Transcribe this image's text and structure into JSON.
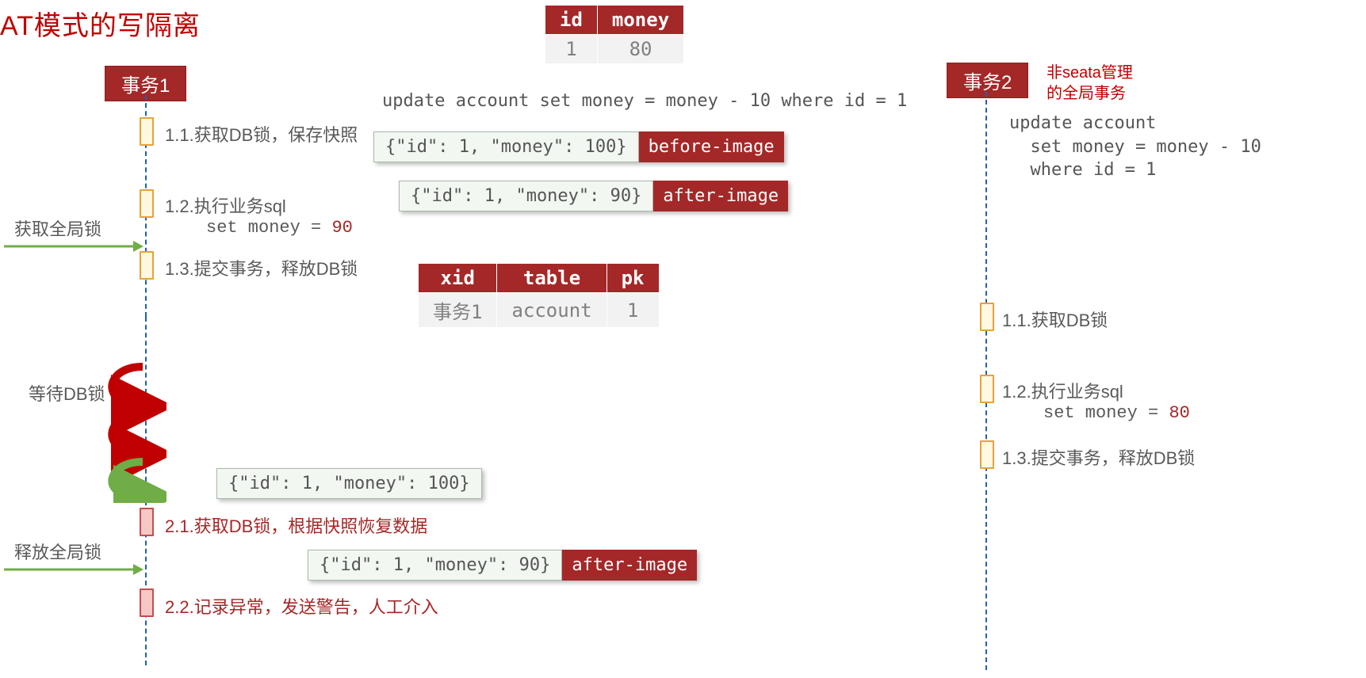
{
  "title": "AT模式的写隔离",
  "tx1": {
    "label": "事务1",
    "steps": {
      "s11": "1.1.获取DB锁，保存快照",
      "s12": "1.2.执行业务sql",
      "s12_set_prefix": "set money = ",
      "s12_set_value": "90",
      "s13": "1.3.提交事务，释放DB锁",
      "s21": "2.1.获取DB锁，根据快照恢复数据",
      "s22": "2.2.记录异常，发送警告，人工介入"
    }
  },
  "tx2": {
    "label": "事务2",
    "red_note_line1": "非seata管理",
    "red_note_line2": "的全局事务",
    "sql_line1": "update account",
    "sql_line2": "  set money = money - 10",
    "sql_line3": "  where id = 1",
    "steps": {
      "s11": "1.1.获取DB锁",
      "s12": "1.2.执行业务sql",
      "s12_set_prefix": "set money = ",
      "s12_set_value": "80",
      "s13": "1.3.提交事务，释放DB锁"
    }
  },
  "side": {
    "get_global_lock": "获取全局锁",
    "wait_db_lock": "等待DB锁",
    "release_global_lock": "释放全局锁"
  },
  "account_table": {
    "headers": {
      "id": "id",
      "money": "money"
    },
    "row": {
      "id": "1",
      "money": "80"
    }
  },
  "global_sql": "update account set money = money - 10 where id = 1",
  "images": {
    "before": {
      "json": "{\"id\": 1, \"money\": 100}",
      "tag": "before-image"
    },
    "after": {
      "json": "{\"id\": 1, \"money\": 90}",
      "tag": "after-image"
    },
    "restore100": {
      "json": "{\"id\": 1, \"money\": 100}"
    },
    "restore90": {
      "json": "{\"id\": 1, \"money\": 90}",
      "tag": "after-image"
    }
  },
  "lock_table": {
    "headers": {
      "xid": "xid",
      "table": "table",
      "pk": "pk"
    },
    "row": {
      "xid": "事务1",
      "table": "account",
      "pk": "1"
    }
  }
}
